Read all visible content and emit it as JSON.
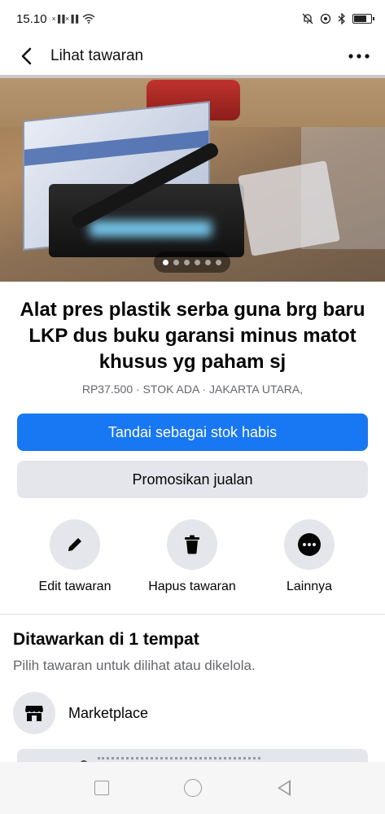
{
  "status_bar": {
    "time": "15.10",
    "signal": "×▐▐ ×▐▐",
    "wifi": "▿"
  },
  "app_bar": {
    "title": "Lihat tawaran"
  },
  "listing": {
    "title": "Alat pres plastik serba guna brg baru LKP dus buku garansi minus matot khusus yg paham sj",
    "meta": "RP37.500 · STOK ADA · JAKARTA UTARA,",
    "photo_count": 6,
    "active_photo": 1
  },
  "buttons": {
    "mark_sold": "Tandai sebagai stok habis",
    "promote": "Promosikan jualan"
  },
  "actions": [
    {
      "label": "Edit tawaran",
      "icon": "pencil-icon"
    },
    {
      "label": "Hapus tawaran",
      "icon": "trash-icon"
    },
    {
      "label": "Lainnya",
      "icon": "more-horizontal-icon"
    }
  ],
  "offered_section": {
    "title": "Ditawarkan di 1 tempat",
    "subtitle": "Pilih tawaran untuk dilihat atau dikelola.",
    "places": [
      {
        "label": "Marketplace",
        "icon": "marketplace-store-icon"
      }
    ]
  },
  "colors": {
    "primary": "#1877f2",
    "secondary_bg": "#e4e6eb",
    "muted_text": "#65676b"
  }
}
